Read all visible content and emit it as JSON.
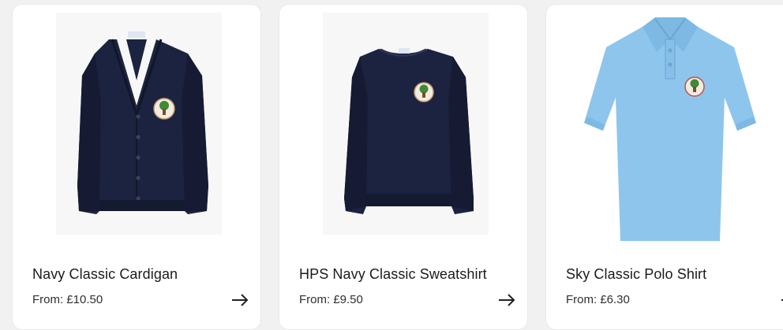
{
  "products": [
    {
      "title": "Navy Classic Cardigan",
      "price": "From: £10.50",
      "image_icon": "navy-cardigan-image",
      "arrow_icon": "arrow-right-icon"
    },
    {
      "title": "HPS Navy Classic Sweatshirt",
      "price": "From: £9.50",
      "image_icon": "navy-sweatshirt-image",
      "arrow_icon": "arrow-right-icon"
    },
    {
      "title": "Sky Classic Polo Shirt",
      "price": "From: £6.30",
      "image_icon": "sky-polo-shirt-image",
      "arrow_icon": "arrow-right-icon"
    }
  ],
  "colors": {
    "navy": "#1c2340",
    "sky": "#8ec5ec",
    "card": "#ffffff",
    "page": "#f1f1f1"
  }
}
